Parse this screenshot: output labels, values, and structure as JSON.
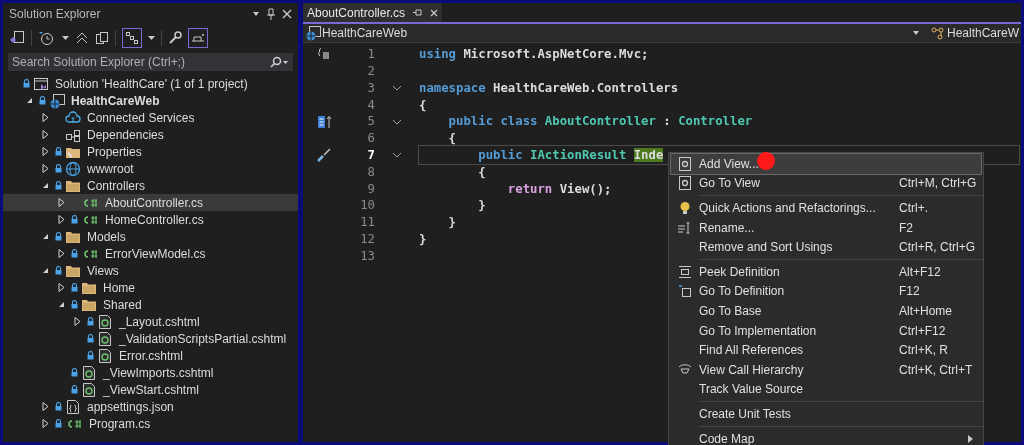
{
  "solution_explorer": {
    "title": "Solution Explorer",
    "search": {
      "placeholder": "Search Solution Explorer (Ctrl+;)"
    },
    "tree": [
      {
        "label": "Solution 'HealthCare'   (1 of 1 project)",
        "kind": "solution",
        "locked": true,
        "children": [
          {
            "label": "HealthCareWeb",
            "kind": "project",
            "bold": true,
            "locked": true,
            "expanded": true,
            "children": [
              {
                "label": "Connected Services",
                "kind": "connected",
                "locked": false,
                "expanded": false
              },
              {
                "label": "Dependencies",
                "kind": "deps",
                "locked": false,
                "expanded": false
              },
              {
                "label": "Properties",
                "kind": "properties",
                "locked": true,
                "expanded": false
              },
              {
                "label": "wwwroot",
                "kind": "globe",
                "locked": true,
                "expanded": false
              },
              {
                "label": "Controllers",
                "kind": "folder",
                "locked": true,
                "expanded": true,
                "children": [
                  {
                    "label": "AboutController.cs",
                    "kind": "cs",
                    "locked": false,
                    "expanded": false,
                    "selected": true
                  },
                  {
                    "label": "HomeController.cs",
                    "kind": "cs",
                    "locked": true,
                    "expanded": false,
                    "selected": false
                  }
                ]
              },
              {
                "label": "Models",
                "kind": "folder",
                "locked": true,
                "expanded": true,
                "children": [
                  {
                    "label": "ErrorViewModel.cs",
                    "kind": "cs",
                    "locked": true,
                    "expanded": false
                  }
                ]
              },
              {
                "label": "Views",
                "kind": "folder",
                "locked": true,
                "expanded": true,
                "children": [
                  {
                    "label": "Home",
                    "kind": "folder",
                    "locked": true,
                    "expanded": false
                  },
                  {
                    "label": "Shared",
                    "kind": "folder",
                    "locked": true,
                    "expanded": true,
                    "children": [
                      {
                        "label": "_Layout.cshtml",
                        "kind": "cshtml",
                        "locked": true,
                        "expanded": false
                      },
                      {
                        "label": "_ValidationScriptsPartial.cshtml",
                        "kind": "cshtml",
                        "locked": true
                      },
                      {
                        "label": "Error.cshtml",
                        "kind": "cshtml",
                        "locked": true
                      }
                    ]
                  },
                  {
                    "label": "_ViewImports.cshtml",
                    "kind": "cshtml",
                    "locked": true
                  },
                  {
                    "label": "_ViewStart.cshtml",
                    "kind": "cshtml",
                    "locked": true
                  }
                ]
              },
              {
                "label": "appsettings.json",
                "kind": "json",
                "locked": true,
                "expanded": false
              },
              {
                "label": "Program.cs",
                "kind": "cs",
                "locked": true,
                "expanded": false
              }
            ]
          }
        ]
      }
    ]
  },
  "editor": {
    "tab": {
      "label": "AboutController.cs",
      "selected": true
    },
    "nav_left": "HealthCareWeb",
    "nav_right": "HealthCareW",
    "lines": [
      {
        "number": "1",
        "gutter": {
          "kind": "braces"
        },
        "fold": false,
        "current": false,
        "tokens": [
          {
            "kind": "keyword",
            "text": "using"
          },
          {
            "kind": "plain",
            "text": " Microsoft.AspNetCore.Mvc;"
          }
        ]
      },
      {
        "number": "2",
        "fold": false,
        "current": false
      },
      {
        "number": "3",
        "fold": true,
        "current": false,
        "tokens": [
          {
            "kind": "keyword",
            "text": "namespace"
          },
          {
            "kind": "plain",
            "text": " HealthCareWeb.Controllers"
          }
        ]
      },
      {
        "number": "4",
        "fold": false,
        "current": false,
        "tokens": [
          {
            "kind": "plain",
            "text": "{"
          }
        ]
      },
      {
        "number": "5",
        "gutter": {
          "kind": "hierarchy"
        },
        "fold": true,
        "current": false,
        "tokens": [
          {
            "kind": "keyword",
            "text": "    public class"
          },
          {
            "kind": "type",
            "text": " AboutController"
          },
          {
            "kind": "plain",
            "text": " : "
          },
          {
            "kind": "type",
            "text": "Controller"
          }
        ]
      },
      {
        "number": "6",
        "fold": false,
        "current": false,
        "tokens": [
          {
            "kind": "plain",
            "text": "    {"
          }
        ]
      },
      {
        "number": "7",
        "gutter": {
          "kind": "screwdriver"
        },
        "fold": true,
        "current": true,
        "tokens": [
          {
            "kind": "keyword",
            "text": "        public"
          },
          {
            "kind": "type",
            "text": " IActionResult "
          },
          {
            "kind": "highlight",
            "text": "Inde"
          }
        ]
      },
      {
        "number": "8",
        "fold": false,
        "current": false,
        "tokens": [
          {
            "kind": "plain",
            "text": "        {"
          }
        ]
      },
      {
        "number": "9",
        "fold": false,
        "current": false,
        "tokens": [
          {
            "kind": "control",
            "text": "            return"
          },
          {
            "kind": "plain",
            "text": " View();"
          }
        ]
      },
      {
        "number": "10",
        "fold": false,
        "current": false,
        "tokens": [
          {
            "kind": "plain",
            "text": "        }"
          }
        ]
      },
      {
        "number": "11",
        "fold": false,
        "current": false,
        "tokens": [
          {
            "kind": "plain",
            "text": "    }"
          }
        ]
      },
      {
        "number": "12",
        "fold": false,
        "current": false,
        "tokens": [
          {
            "kind": "plain",
            "text": "}"
          }
        ]
      },
      {
        "number": "13",
        "fold": false,
        "current": false
      }
    ]
  },
  "context_menu": [
    {
      "kind": "item",
      "label": "Add View...",
      "icon": {
        "kind": "razor"
      },
      "highlighted": true
    },
    {
      "kind": "item",
      "label": "Go To View",
      "shortcut": "Ctrl+M, Ctrl+G",
      "icon": {
        "kind": "razor"
      },
      "highlighted": false
    },
    {
      "kind": "separator"
    },
    {
      "kind": "item",
      "label": "Quick Actions and Refactorings...",
      "shortcut": "Ctrl+.",
      "icon": {
        "kind": "bulb"
      },
      "highlighted": false
    },
    {
      "kind": "item",
      "label": "Rename...",
      "shortcut": "F2",
      "icon": {
        "kind": "rename"
      },
      "highlighted": false
    },
    {
      "kind": "item",
      "label": "Remove and Sort Usings",
      "shortcut": "Ctrl+R, Ctrl+G",
      "highlighted": false
    },
    {
      "kind": "separator"
    },
    {
      "kind": "item",
      "label": "Peek Definition",
      "shortcut": "Alt+F12",
      "icon": {
        "kind": "peek"
      },
      "highlighted": false
    },
    {
      "kind": "item",
      "label": "Go To Definition",
      "shortcut": "F12",
      "icon": {
        "kind": "definition"
      },
      "highlighted": false
    },
    {
      "kind": "item",
      "label": "Go To Base",
      "shortcut": "Alt+Home",
      "highlighted": false
    },
    {
      "kind": "item",
      "label": "Go To Implementation",
      "shortcut": "Ctrl+F12",
      "highlighted": false
    },
    {
      "kind": "item",
      "label": "Find All References",
      "shortcut": "Ctrl+K, R",
      "highlighted": false
    },
    {
      "kind": "item",
      "label": "View Call Hierarchy",
      "shortcut": "Ctrl+K, Ctrl+T",
      "icon": {
        "kind": "hierarchy"
      },
      "highlighted": false
    },
    {
      "kind": "item",
      "label": "Track Value Source",
      "highlighted": false
    },
    {
      "kind": "separator"
    },
    {
      "kind": "item",
      "label": "Create Unit Tests",
      "highlighted": false
    },
    {
      "kind": "separator"
    },
    {
      "kind": "item",
      "label": "Code Map",
      "submenu": true,
      "highlighted": false
    }
  ],
  "pointer_marker": {
    "color": "#ff1a1a"
  }
}
